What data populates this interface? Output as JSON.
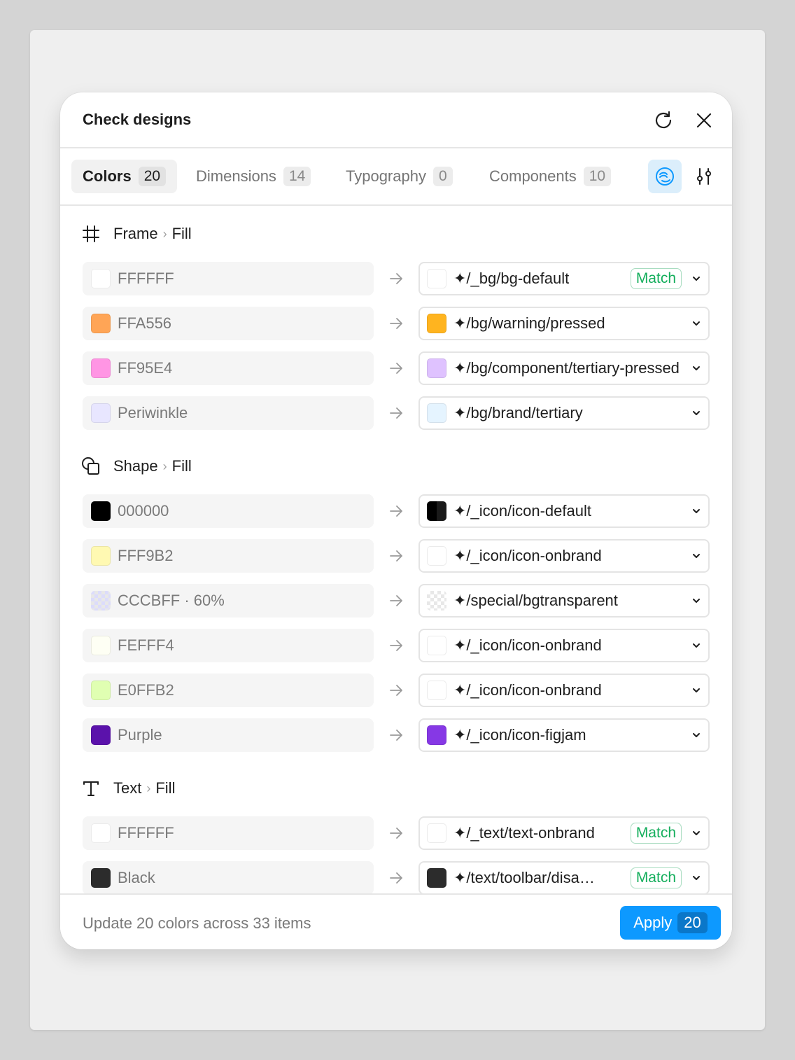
{
  "dialog": {
    "title": "Check designs",
    "refresh_icon": "refresh-icon",
    "close_icon": "close-icon"
  },
  "tabs": [
    {
      "label": "Colors",
      "count": "20",
      "active": true
    },
    {
      "label": "Dimensions",
      "count": "14",
      "active": false
    },
    {
      "label": "Typography",
      "count": "0",
      "active": false
    },
    {
      "label": "Components",
      "count": "10",
      "active": false
    }
  ],
  "toolbar": {
    "library_icon": "library-icon",
    "settings_icon": "sliders-icon"
  },
  "sections": [
    {
      "name": "Frame",
      "property": "Fill",
      "icon": "frame-icon",
      "rows": [
        {
          "source": "FFFFFF",
          "source_color": "#FFFFFF",
          "target": "✦/_bg/bg-default",
          "target_color": "#FFFFFF",
          "match": "Match"
        },
        {
          "source": "FFA556",
          "source_color": "#FFA556",
          "target": "✦/bg/warning/pressed",
          "target_color": "#FFB41F",
          "match": ""
        },
        {
          "source": "FF95E4",
          "source_color": "#FF95E4",
          "target": "✦/bg/component/tertiary-pressed",
          "target_color": "#DFC2FF",
          "match": ""
        },
        {
          "source": "Periwinkle",
          "source_color": "#E8E6FF",
          "target": "✦/bg/brand/tertiary",
          "target_color": "#E5F4FF",
          "match": ""
        }
      ]
    },
    {
      "name": "Shape",
      "property": "Fill",
      "icon": "shape-icon",
      "rows": [
        {
          "source": "000000",
          "source_color": "#000000",
          "target": "✦/_icon/icon-default",
          "target_color": "#000000",
          "match": ""
        },
        {
          "source": "FFF9B2",
          "source_color": "#FFF9B2",
          "target": "✦/_icon/icon-onbrand",
          "target_color": "#FFFFFF",
          "match": ""
        },
        {
          "source": "CCCBFF · 60%",
          "source_color": "#CCCBFF",
          "target": "✦/special/bgtransparent",
          "target_color": "transparent",
          "match": ""
        },
        {
          "source": "FEFFF4",
          "source_color": "#FEFFF4",
          "target": "✦/_icon/icon-onbrand",
          "target_color": "#FFFFFF",
          "match": ""
        },
        {
          "source": "E0FFB2",
          "source_color": "#E0FFB2",
          "target": "✦/_icon/icon-onbrand",
          "target_color": "#FFFFFF",
          "match": ""
        },
        {
          "source": "Purple",
          "source_color": "#5B12AB",
          "target": "✦/_icon/icon-figjam",
          "target_color": "#8638E5",
          "match": ""
        }
      ]
    },
    {
      "name": "Text",
      "property": "Fill",
      "icon": "text-icon",
      "rows": [
        {
          "source": "FFFFFF",
          "source_color": "#FFFFFF",
          "target": "✦/_text/text-onbrand",
          "target_color": "#FFFFFF",
          "match": "Match"
        },
        {
          "source": "Black",
          "source_color": "#2C2C2C",
          "target": "✦/text/toolbar/disa…",
          "target_color": "#2C2C2C",
          "match": "Match"
        }
      ]
    }
  ],
  "footer": {
    "summary": "Update 20 colors across 33 items",
    "apply_label": "Apply",
    "apply_count": "20"
  },
  "colors": {
    "accent": "#0D99FF",
    "match_green": "#14AE5C"
  }
}
